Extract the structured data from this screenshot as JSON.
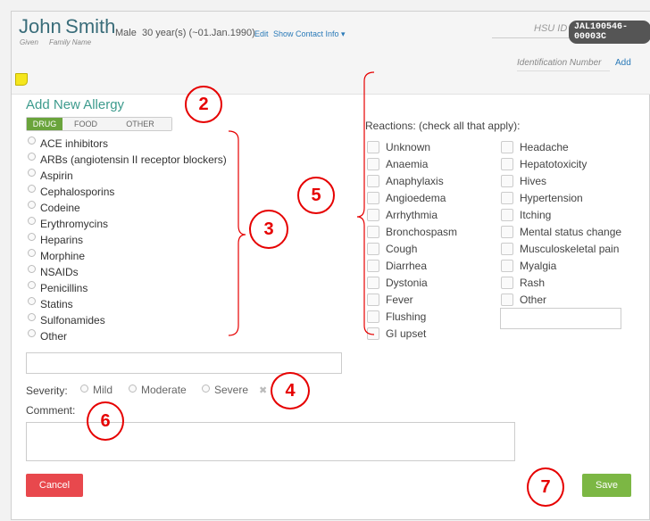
{
  "patient": {
    "given_name": "John",
    "family_name": "Smith",
    "given_label": "Given",
    "family_label": "Family Name",
    "details": "Male  30 year(s) (~01.Jan.1990)",
    "edit_link": "Edit",
    "contact_link": "Show Contact Info ▾",
    "hsu_label": "HSU ID",
    "hsu_id": "JAL100546-00003C",
    "id_number_label": "Identification Number",
    "add_link": "Add"
  },
  "allergy": {
    "title": "Add New Allergy",
    "tabs": [
      "DRUG",
      "FOOD",
      "OTHER"
    ],
    "active_tab": "DRUG",
    "drugs": [
      "ACE inhibitors",
      "ARBs (angiotensin II receptor blockers)",
      "Aspirin",
      "Cephalosporins",
      "Codeine",
      "Erythromycins",
      "Heparins",
      "Morphine",
      "NSAIDs",
      "Penicillins",
      "Statins",
      "Sulfonamides",
      "Other"
    ],
    "other_value": ""
  },
  "reactions": {
    "label": "Reactions: (check all that apply):",
    "col1": [
      "Unknown",
      "Anaemia",
      "Anaphylaxis",
      "Angioedema",
      "Arrhythmia",
      "Bronchospasm",
      "Cough",
      "Diarrhea",
      "Dystonia",
      "Fever",
      "Flushing",
      "GI upset"
    ],
    "col2": [
      "Headache",
      "Hepatotoxicity",
      "Hives",
      "Hypertension",
      "Itching",
      "Mental status change",
      "Musculoskeletal pain",
      "Myalgia",
      "Rash",
      "Other"
    ],
    "other_value": ""
  },
  "severity": {
    "label": "Severity:",
    "options": [
      "Mild",
      "Moderate",
      "Severe"
    ],
    "clear_symbol": "✖"
  },
  "comment": {
    "label": "Comment:",
    "value": ""
  },
  "buttons": {
    "cancel": "Cancel",
    "save": "Save"
  },
  "annotations": [
    "2",
    "3",
    "4",
    "5",
    "6",
    "7"
  ],
  "colors": {
    "accent_green": "#6aa43c",
    "title_teal": "#3d9b8d",
    "cancel_red": "#e8484d",
    "save_green": "#7cb744",
    "annotation_red": "#e60000"
  }
}
